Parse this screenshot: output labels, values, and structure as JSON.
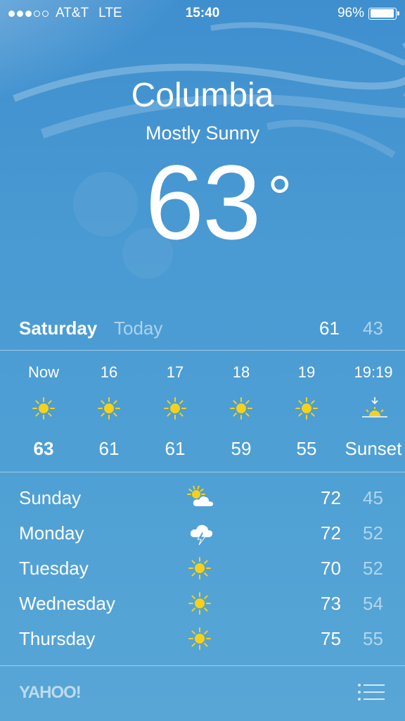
{
  "status": {
    "carrier": "AT&T",
    "network": "LTE",
    "time": "15:40",
    "battery": "96%",
    "battery_level": 0.96,
    "signal_bars_filled": 3,
    "signal_bars_total": 5
  },
  "location": {
    "city": "Columbia",
    "condition": "Mostly Sunny",
    "temperature": "63",
    "degree_symbol": "°"
  },
  "today": {
    "day": "Saturday",
    "label": "Today",
    "high": "61",
    "low": "43"
  },
  "hourly": [
    {
      "time": "Now",
      "icon": "sun-icon",
      "temp": "63"
    },
    {
      "time": "16",
      "icon": "sun-icon",
      "temp": "61"
    },
    {
      "time": "17",
      "icon": "sun-icon",
      "temp": "61"
    },
    {
      "time": "18",
      "icon": "sun-icon",
      "temp": "59"
    },
    {
      "time": "19",
      "icon": "sun-icon",
      "temp": "55"
    },
    {
      "time": "19:19",
      "icon": "sunset-icon",
      "temp": "Sunset"
    }
  ],
  "daily": [
    {
      "day": "Sunday",
      "icon": "partly-cloudy-icon",
      "high": "72",
      "low": "45"
    },
    {
      "day": "Monday",
      "icon": "thunderstorm-icon",
      "high": "72",
      "low": "52"
    },
    {
      "day": "Tuesday",
      "icon": "sun-icon",
      "high": "70",
      "low": "52"
    },
    {
      "day": "Wednesday",
      "icon": "sun-icon",
      "high": "73",
      "low": "54"
    },
    {
      "day": "Thursday",
      "icon": "sun-icon",
      "high": "75",
      "low": "55"
    }
  ],
  "footer": {
    "brand": "YAHOO!",
    "menu_icon": "list-icon"
  },
  "colors": {
    "sun": "#f7d117",
    "background_top": "#3f8fcf",
    "background_bottom": "#58a6d6"
  }
}
